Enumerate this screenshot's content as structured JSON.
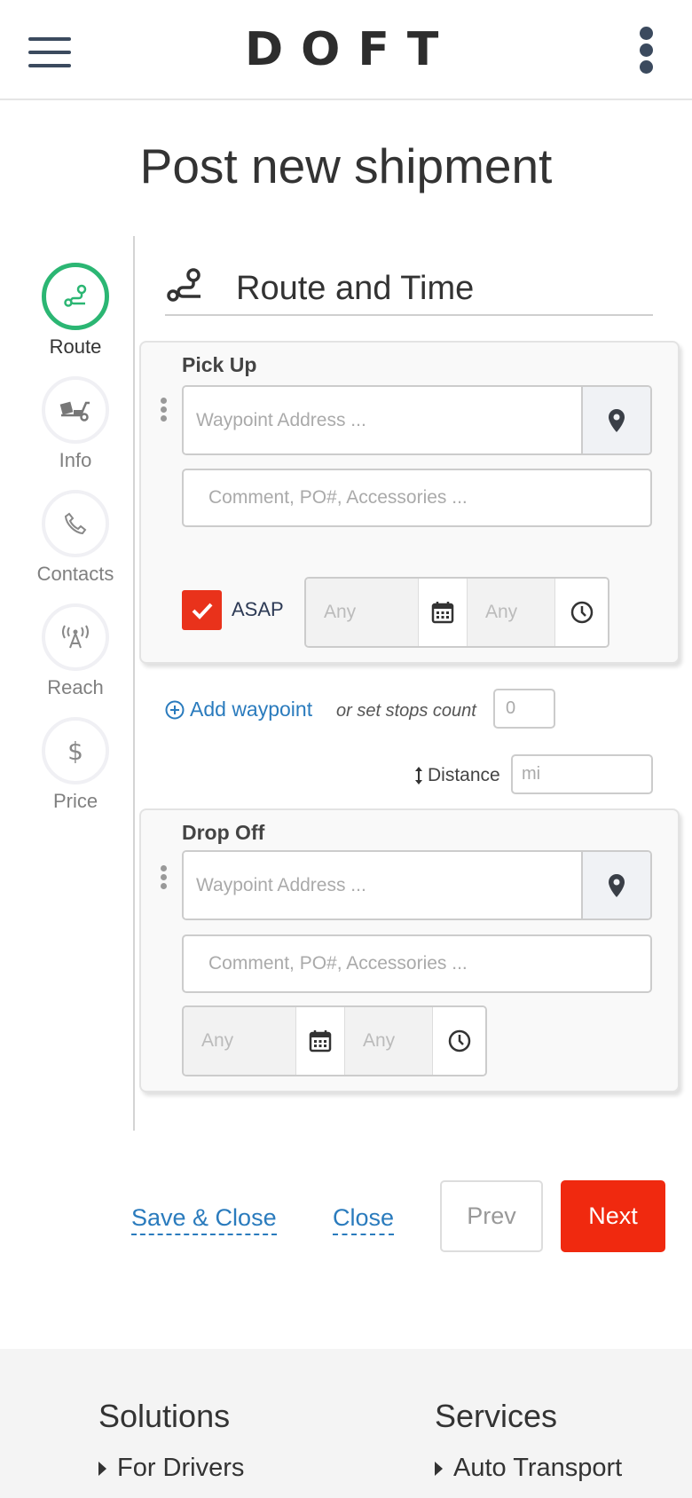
{
  "header": {
    "logo": "DOFT"
  },
  "page_title": "Post new shipment",
  "stepper": [
    {
      "label": "Route",
      "icon": "route-icon",
      "active": true
    },
    {
      "label": "Info",
      "icon": "truck-icon",
      "active": false
    },
    {
      "label": "Contacts",
      "icon": "phone-icon",
      "active": false
    },
    {
      "label": "Reach",
      "icon": "broadcast-icon",
      "active": false
    },
    {
      "label": "Price",
      "icon": "dollar-icon",
      "active": false
    }
  ],
  "section": {
    "title": "Route and Time"
  },
  "pickup": {
    "title": "Pick Up",
    "address_placeholder": "Waypoint Address ...",
    "comment_placeholder": "Comment, PO#, Accessories ...",
    "asap_label": "ASAP",
    "asap_checked": true,
    "date_placeholder": "Any",
    "time_placeholder": "Any"
  },
  "waypoints": {
    "add_label": "Add waypoint",
    "stops_text": "or set stops count",
    "stops_placeholder": "0",
    "distance_label": "Distance",
    "distance_placeholder": "mi"
  },
  "dropoff": {
    "title": "Drop Off",
    "address_placeholder": "Waypoint Address ...",
    "comment_placeholder": "Comment, PO#, Accessories ...",
    "date_placeholder": "Any",
    "time_placeholder": "Any"
  },
  "actions": {
    "save_close": "Save & Close",
    "close": "Close",
    "prev": "Prev",
    "next": "Next"
  },
  "footer": {
    "solutions": {
      "title": "Solutions",
      "link": "For Drivers"
    },
    "services": {
      "title": "Services",
      "link": "Auto Transport"
    }
  },
  "colors": {
    "accent_green": "#2bb673",
    "accent_red": "#f0290f",
    "link_blue": "#2a7bbd"
  }
}
